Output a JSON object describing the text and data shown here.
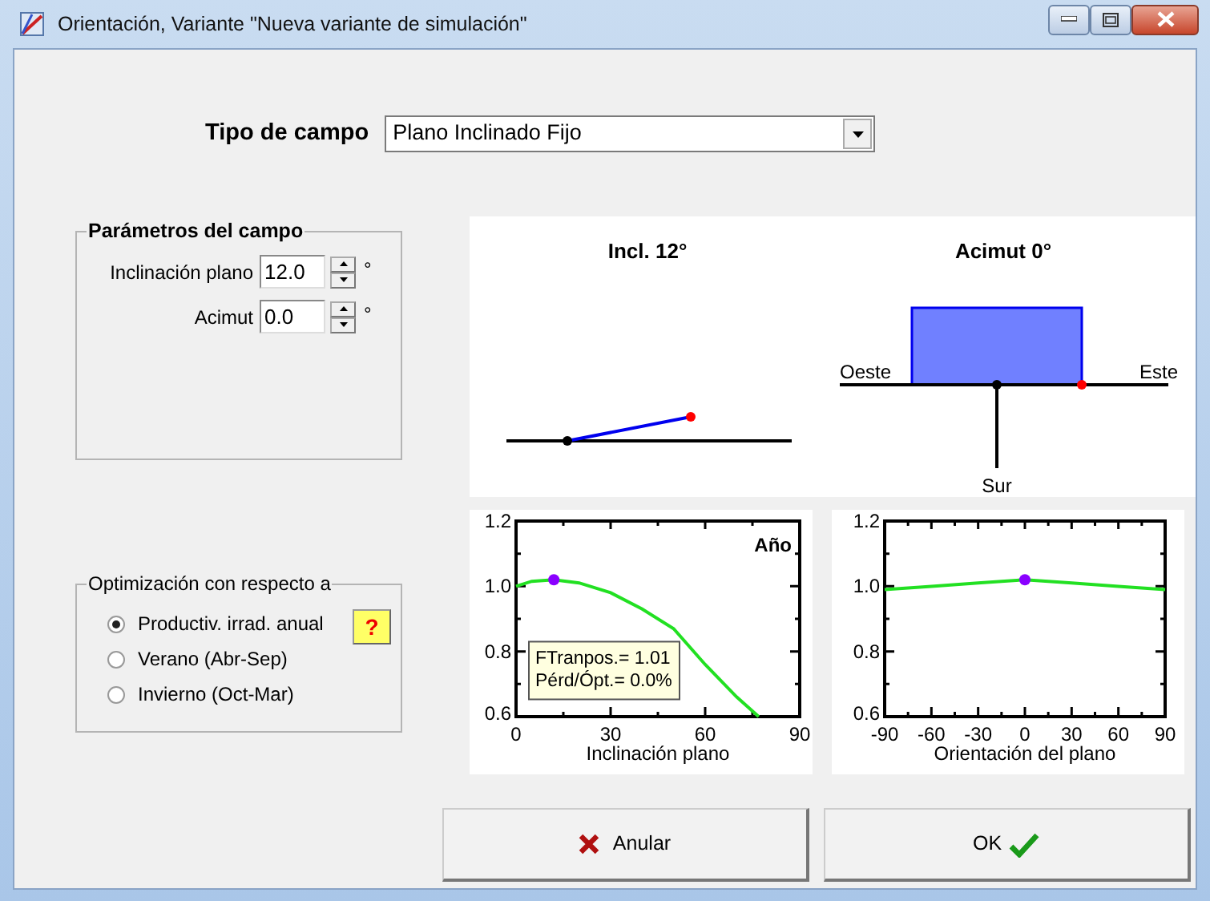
{
  "window": {
    "title": "Orientación, Variante \"Nueva variante de simulación\""
  },
  "field_type": {
    "label": "Tipo de campo",
    "value": "Plano Inclinado Fijo"
  },
  "field_parameters": {
    "title": "Parámetros del campo",
    "inputs": [
      {
        "label": "Inclinación plano",
        "value": "12.0",
        "unit": "°"
      },
      {
        "label": "Acimut",
        "value": "0.0",
        "unit": "°"
      }
    ]
  },
  "optimization": {
    "title": "Optimización con respecto a",
    "help": "?",
    "options": [
      {
        "label": "Productiv. irrad. anual",
        "selected": true
      },
      {
        "label": "Verano (Abr-Sep)",
        "selected": false
      },
      {
        "label": "Invierno (Oct-Mar)",
        "selected": false
      }
    ]
  },
  "diagrams": {
    "tilt_title": "Incl. 12°",
    "azimuth_title": "Acimut 0°",
    "west": "Oeste",
    "east": "Este",
    "south": "Sur"
  },
  "charts": [
    {
      "chart_data": {
        "type": "line",
        "title": "Año",
        "xlabel": "Inclinación plano",
        "xlim": [
          0,
          90
        ],
        "ylim": [
          0.6,
          1.2
        ],
        "xticks": [
          0,
          30,
          60,
          90
        ],
        "yticks": [
          0.6,
          0.8,
          {
            "value": 1,
            "label": "1.0"
          },
          1.2
        ],
        "x": [
          0,
          5,
          12,
          20,
          30,
          40,
          50,
          60,
          70,
          77
        ],
        "series": [
          {
            "color": "#22e022",
            "values": [
              1.0,
              1.015,
              1.02,
              1.01,
              0.98,
              0.93,
              0.87,
              0.76,
              0.66,
              0.6
            ]
          }
        ],
        "annotations": [
          {
            "text": "FTranpos.= 1.01"
          },
          {
            "text": "Pérd/Ópt.= 0.0%"
          }
        ]
      }
    },
    {
      "chart_data": {
        "type": "line",
        "xlabel": "Orientación del plano",
        "xlim": [
          -90,
          90
        ],
        "ylim": [
          0.6,
          1.2
        ],
        "xticks": [
          -90,
          -60,
          -30,
          0,
          30,
          60,
          90
        ],
        "yticks": [
          0.6,
          0.8,
          {
            "value": 1,
            "label": "1.0"
          },
          1.2
        ],
        "x": [
          -90,
          -60,
          -30,
          0,
          30,
          60,
          90
        ],
        "series": [
          {
            "color": "#22e022",
            "values": [
              0.99,
              1.0,
              1.01,
              1.02,
              1.01,
              1.0,
              0.99
            ]
          }
        ]
      }
    }
  ],
  "buttons": [
    {
      "kind": "cancel",
      "label": "Anular"
    },
    {
      "kind": "ok",
      "label": "OK"
    }
  ]
}
